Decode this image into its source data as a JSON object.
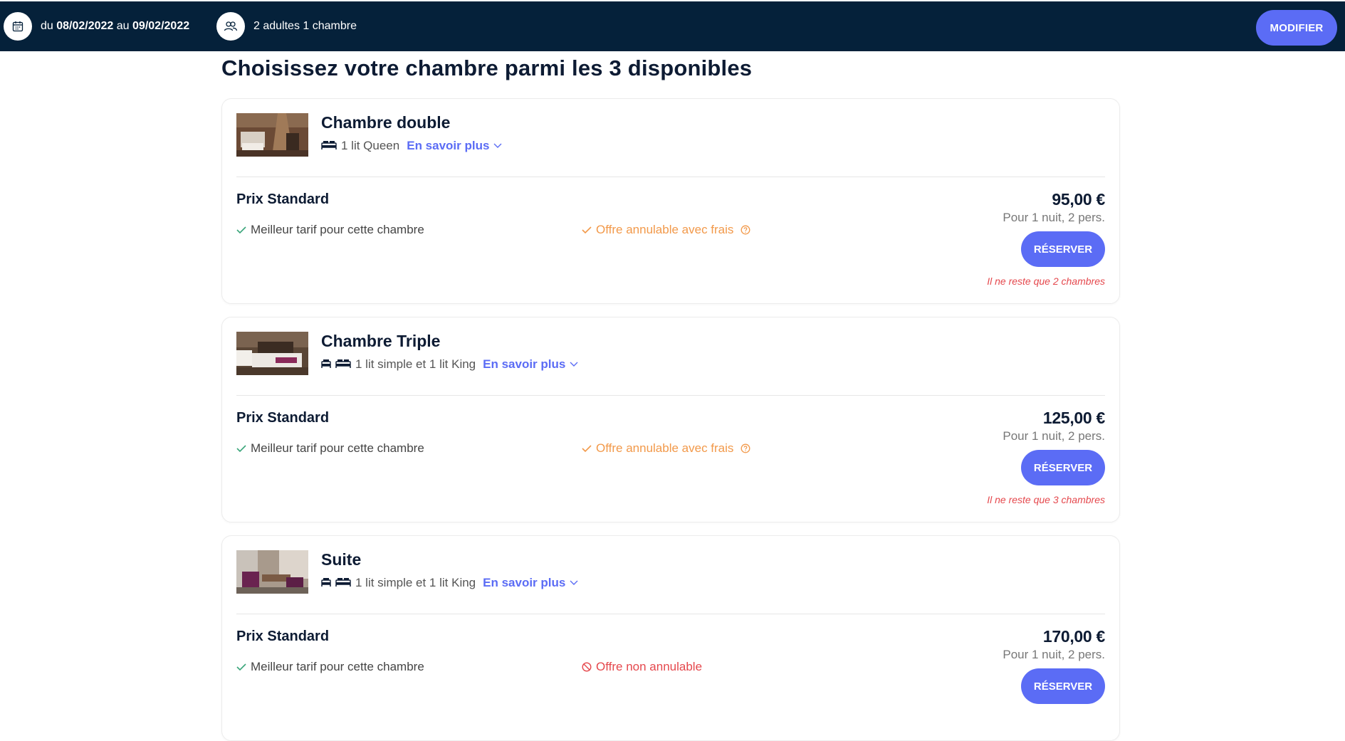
{
  "header": {
    "dates_prefix": "du",
    "date_from": "08/02/2022",
    "dates_middle": "au",
    "date_to": "09/02/2022",
    "guests": "2 adultes 1 chambre",
    "modify_label": "MODIFIER"
  },
  "page_title": "Choisissez votre chambre parmi les 3 disponibles",
  "rooms": [
    {
      "name": "Chambre double",
      "beds": "1 lit Queen",
      "learn_more": "En savoir plus",
      "rate_name": "Prix Standard",
      "best_rate": "Meilleur tarif pour cette chambre",
      "cancellation": "Offre annulable avec frais",
      "price": "95,00 €",
      "price_sub": "Pour 1 nuit, 2 pers.",
      "reserve_label": "RÉSERVER",
      "remaining": "Il ne reste que 2 chambres"
    },
    {
      "name": "Chambre Triple",
      "beds": "1 lit simple et 1 lit King",
      "learn_more": "En savoir plus",
      "rate_name": "Prix Standard",
      "best_rate": "Meilleur tarif pour cette chambre",
      "cancellation": "Offre annulable avec frais",
      "price": "125,00 €",
      "price_sub": "Pour 1 nuit, 2 pers.",
      "reserve_label": "RÉSERVER",
      "remaining": "Il ne reste que 3 chambres"
    },
    {
      "name": "Suite",
      "beds": "1 lit simple et 1 lit King",
      "learn_more": "En savoir plus",
      "rate_name": "Prix Standard",
      "best_rate": "Meilleur tarif pour cette chambre",
      "cancellation": "Offre non annulable",
      "price": "170,00 €",
      "price_sub": "Pour 1 nuit, 2 pers.",
      "reserve_label": "RÉSERVER"
    }
  ],
  "colors": {
    "header_bg": "#05213a",
    "accent": "#5b6cf5",
    "cancel_with_fee": "#f2994a",
    "non_refundable": "#e5484d"
  }
}
